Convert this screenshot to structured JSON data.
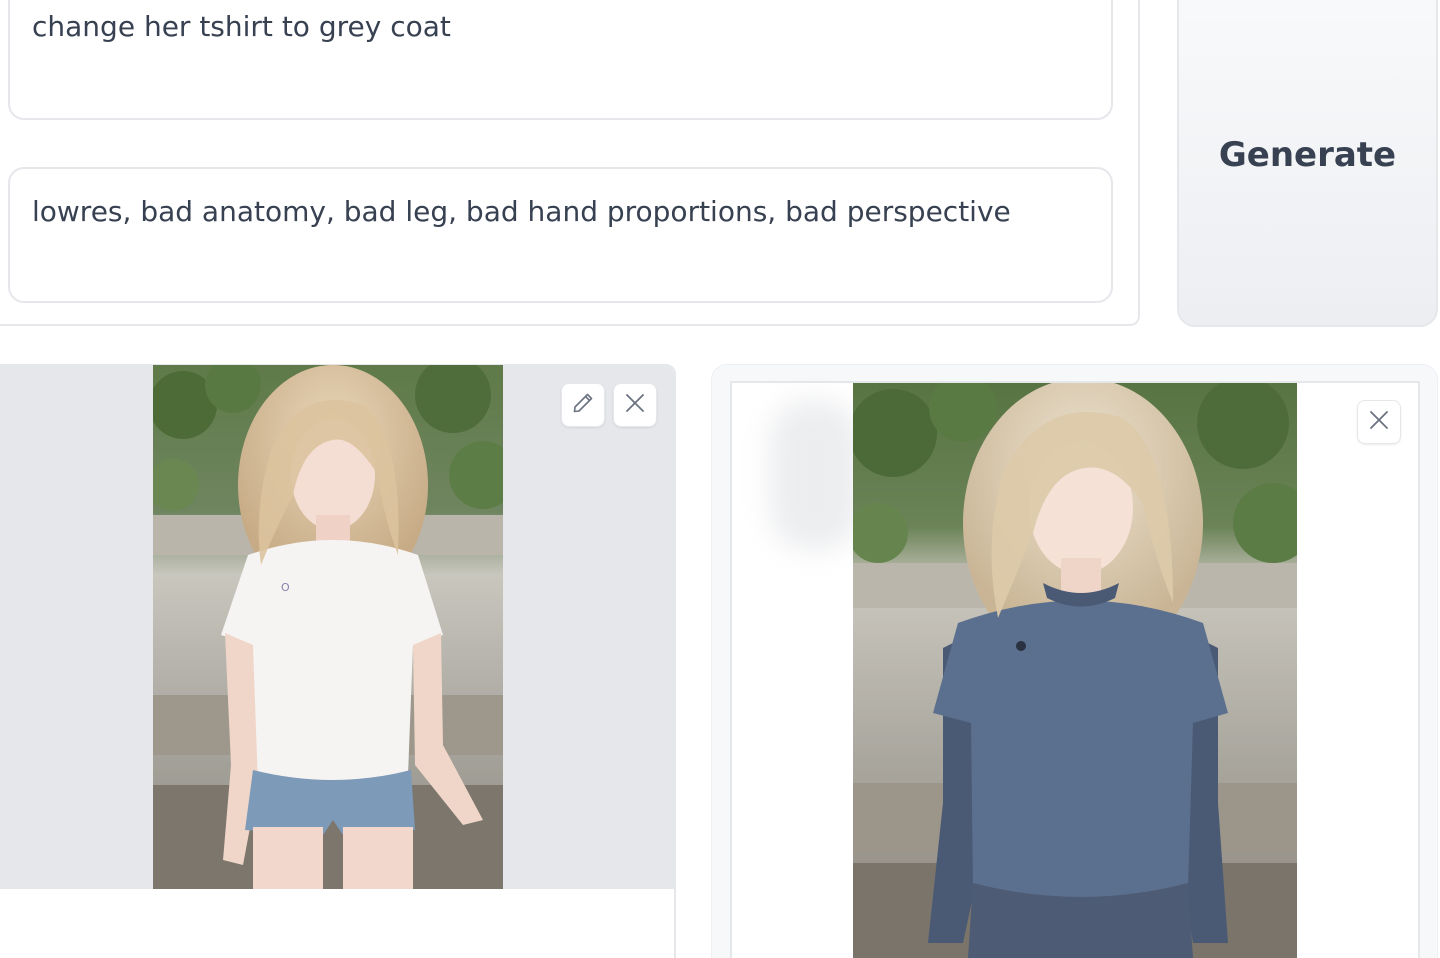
{
  "prompt": {
    "value": "change her tshirt to grey coat"
  },
  "negative_prompt": {
    "value": "lowres, bad anatomy, bad leg, bad hand proportions, bad perspective"
  },
  "generate_button": {
    "label": "Generate"
  },
  "input_image": {
    "edit_icon": "pencil-icon",
    "clear_icon": "close-icon"
  },
  "output_image": {
    "clear_icon": "close-icon"
  },
  "colors": {
    "border": "#e5e7eb",
    "text": "#374151",
    "image_bg": "#e5e7eb"
  }
}
